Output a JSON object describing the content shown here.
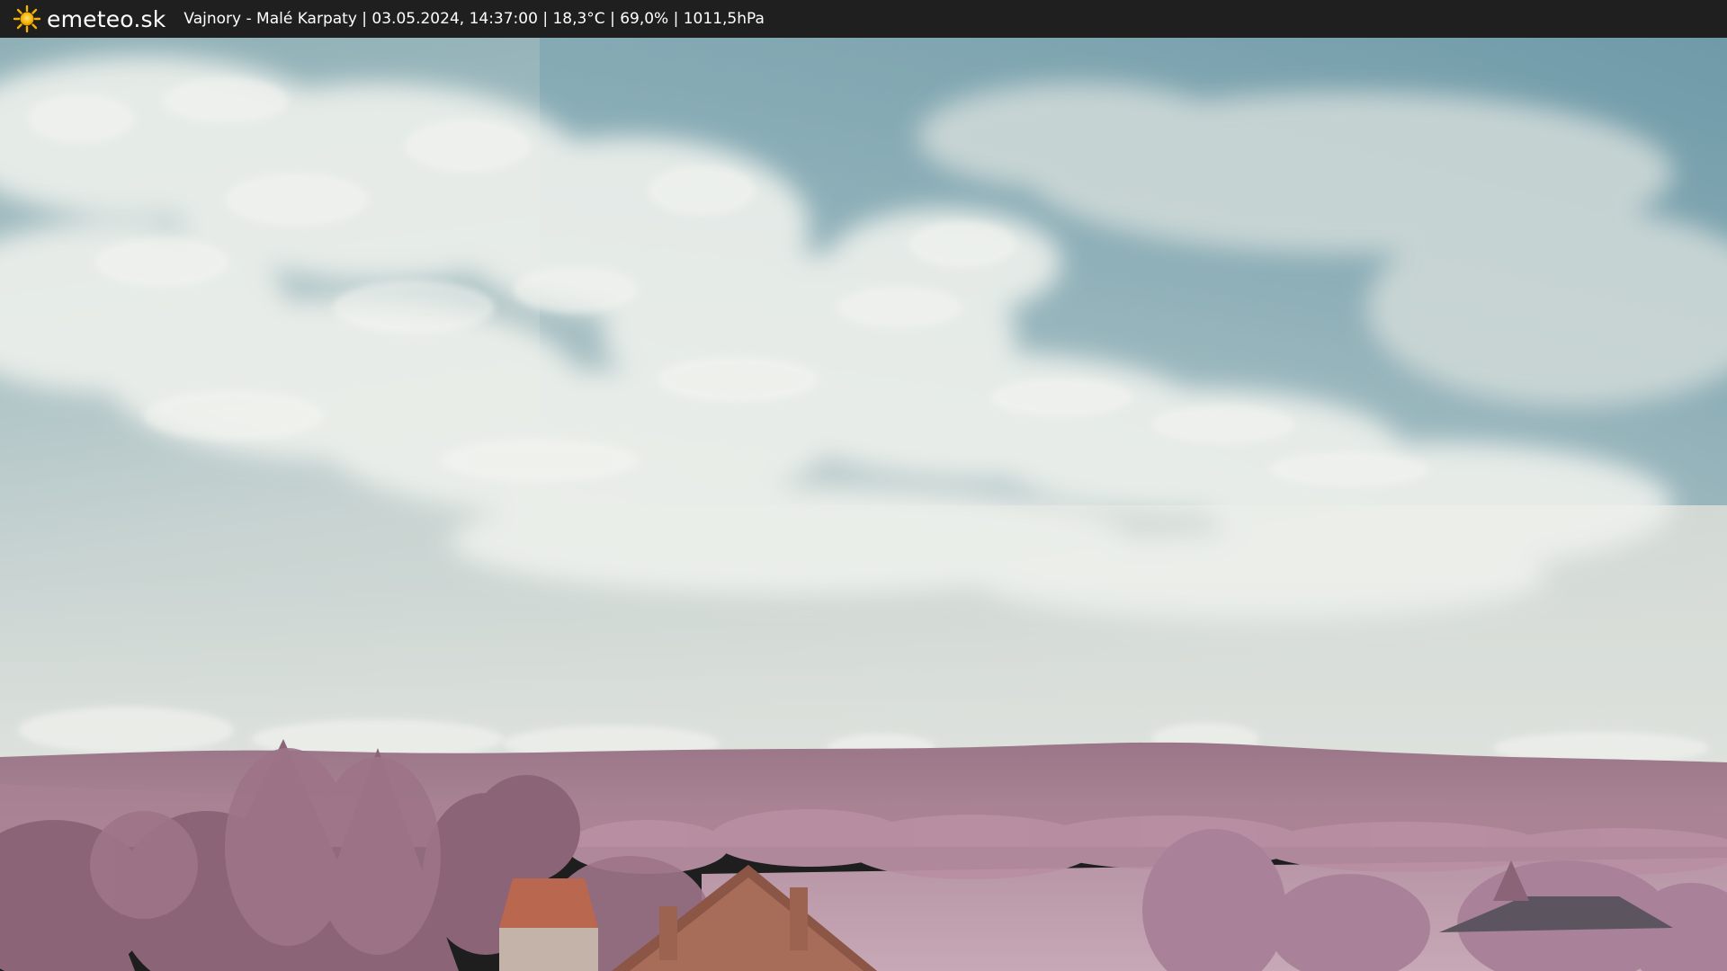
{
  "header": {
    "brand_name": "emeteo.sk",
    "brand_icon": "sun-icon",
    "caption": "Vajnory - Malé Karpaty | 03.05.2024, 14:37:00 | 18,3°C | 69,0% | 1011,5hPa"
  },
  "colors": {
    "bar_background": "#1f1f1f",
    "bar_text": "#ffffff",
    "sun": "#f5b400"
  }
}
